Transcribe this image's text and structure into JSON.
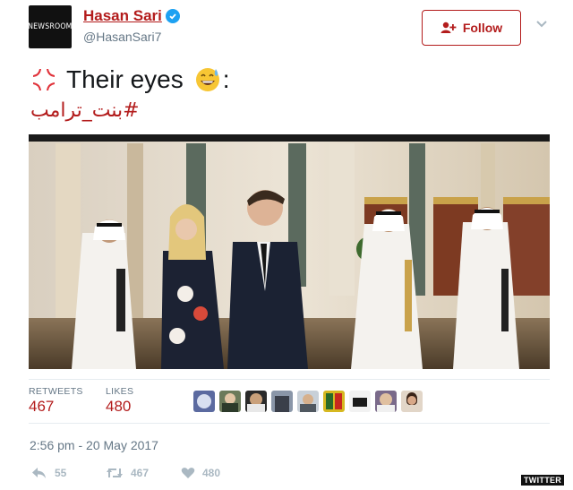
{
  "header": {
    "avatar_text": "NEWSROOM",
    "name": "Hasan Sari",
    "handle": "@HasanSari7",
    "follow_label": "Follow"
  },
  "tweet": {
    "text": "Their eyes",
    "suffix": ":",
    "hashtag": "#بنت_ترامب",
    "icons": [
      "anger-symbol-icon",
      "sweat-smile-emoji-icon"
    ]
  },
  "stats": {
    "retweets_label": "RETWEETS",
    "retweets_count": "467",
    "likes_label": "LIKES",
    "likes_count": "480"
  },
  "timestamp": "2:56 pm - 20 May 2017",
  "actions": {
    "reply_count": "55",
    "retweet_count": "467",
    "like_count": "480"
  },
  "source_tag": "TWITTER",
  "colors": {
    "accent": "#b31c1c",
    "muted": "#657786",
    "verified": "#1da1f2"
  }
}
